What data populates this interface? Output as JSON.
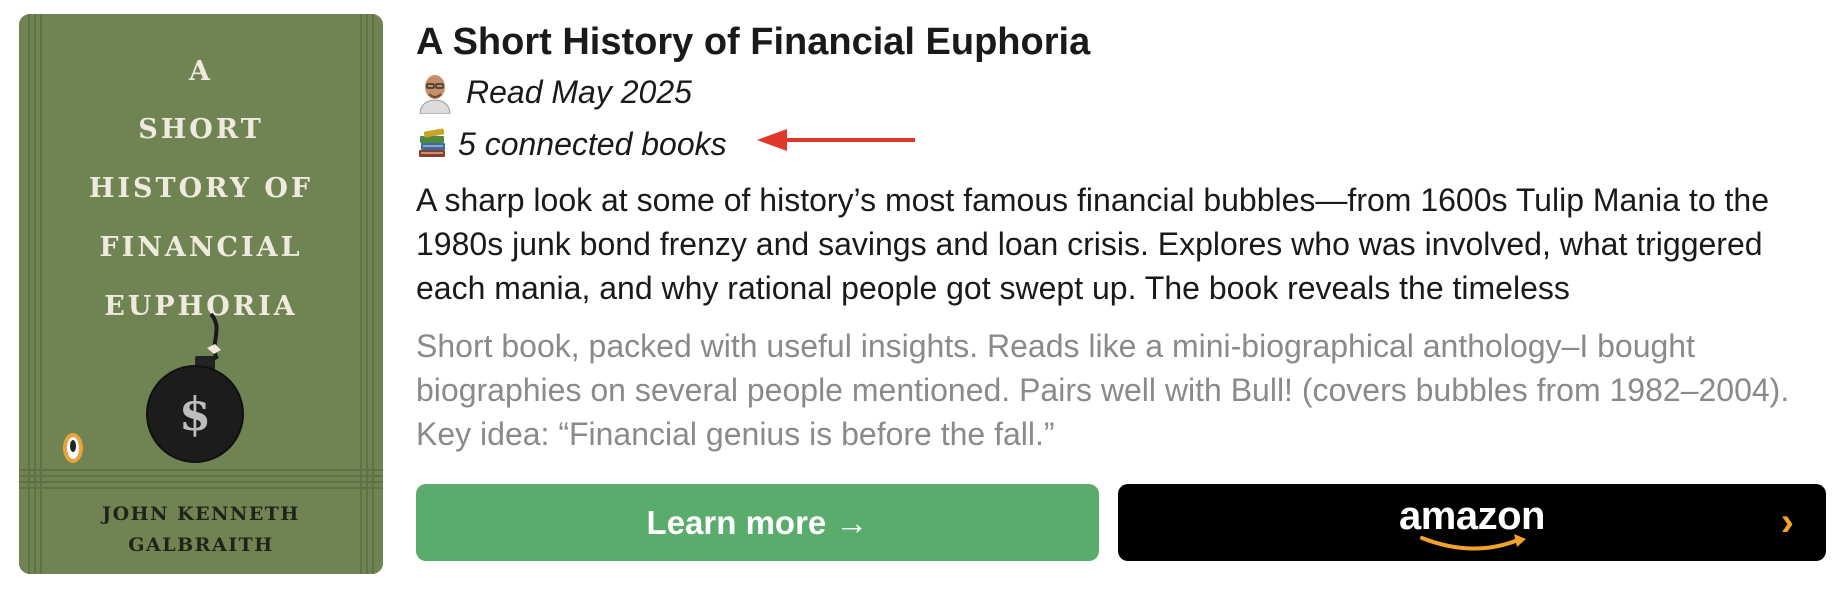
{
  "book": {
    "cover_title_lines": [
      "A",
      "SHORT",
      "HISTORY OF",
      "FINANCIAL",
      "EUPHORIA"
    ],
    "cover_author_lines": [
      "JOHN KENNETH",
      "GALBRAITH"
    ],
    "title": "A Short History of Financial Euphoria",
    "read_date": "Read May 2025",
    "connected": "5 connected books",
    "description": "A sharp look at some of history’s most famous financial bubbles—from 1600s Tulip Mania to the 1980s junk bond frenzy and savings and loan crisis. Explores who was involved, what triggered each mania, and why rational people got swept up. The book reveals the timeless",
    "note": "Short book, packed with useful insights. Reads like a mini-biographical anthology–I bought biographies on several people mentioned. Pairs well with Bull! (covers bubbles from 1982–2004). Key idea: “Financial genius is before the fall.”"
  },
  "buttons": {
    "learn_more": "Learn more →",
    "amazon": "amazon",
    "amazon_chevron": "›"
  },
  "icons": {
    "avatar": "reader-avatar",
    "books": "books-stack-icon",
    "arrow": "red-arrow-pointer"
  },
  "colors": {
    "learn_more_bg": "#5aac6c",
    "amazon_bg": "#000000",
    "amazon_accent": "#f1a22b",
    "arrow": "#e0392b",
    "cover_bg": "#6f8452",
    "note_text": "#8a8a8a"
  }
}
